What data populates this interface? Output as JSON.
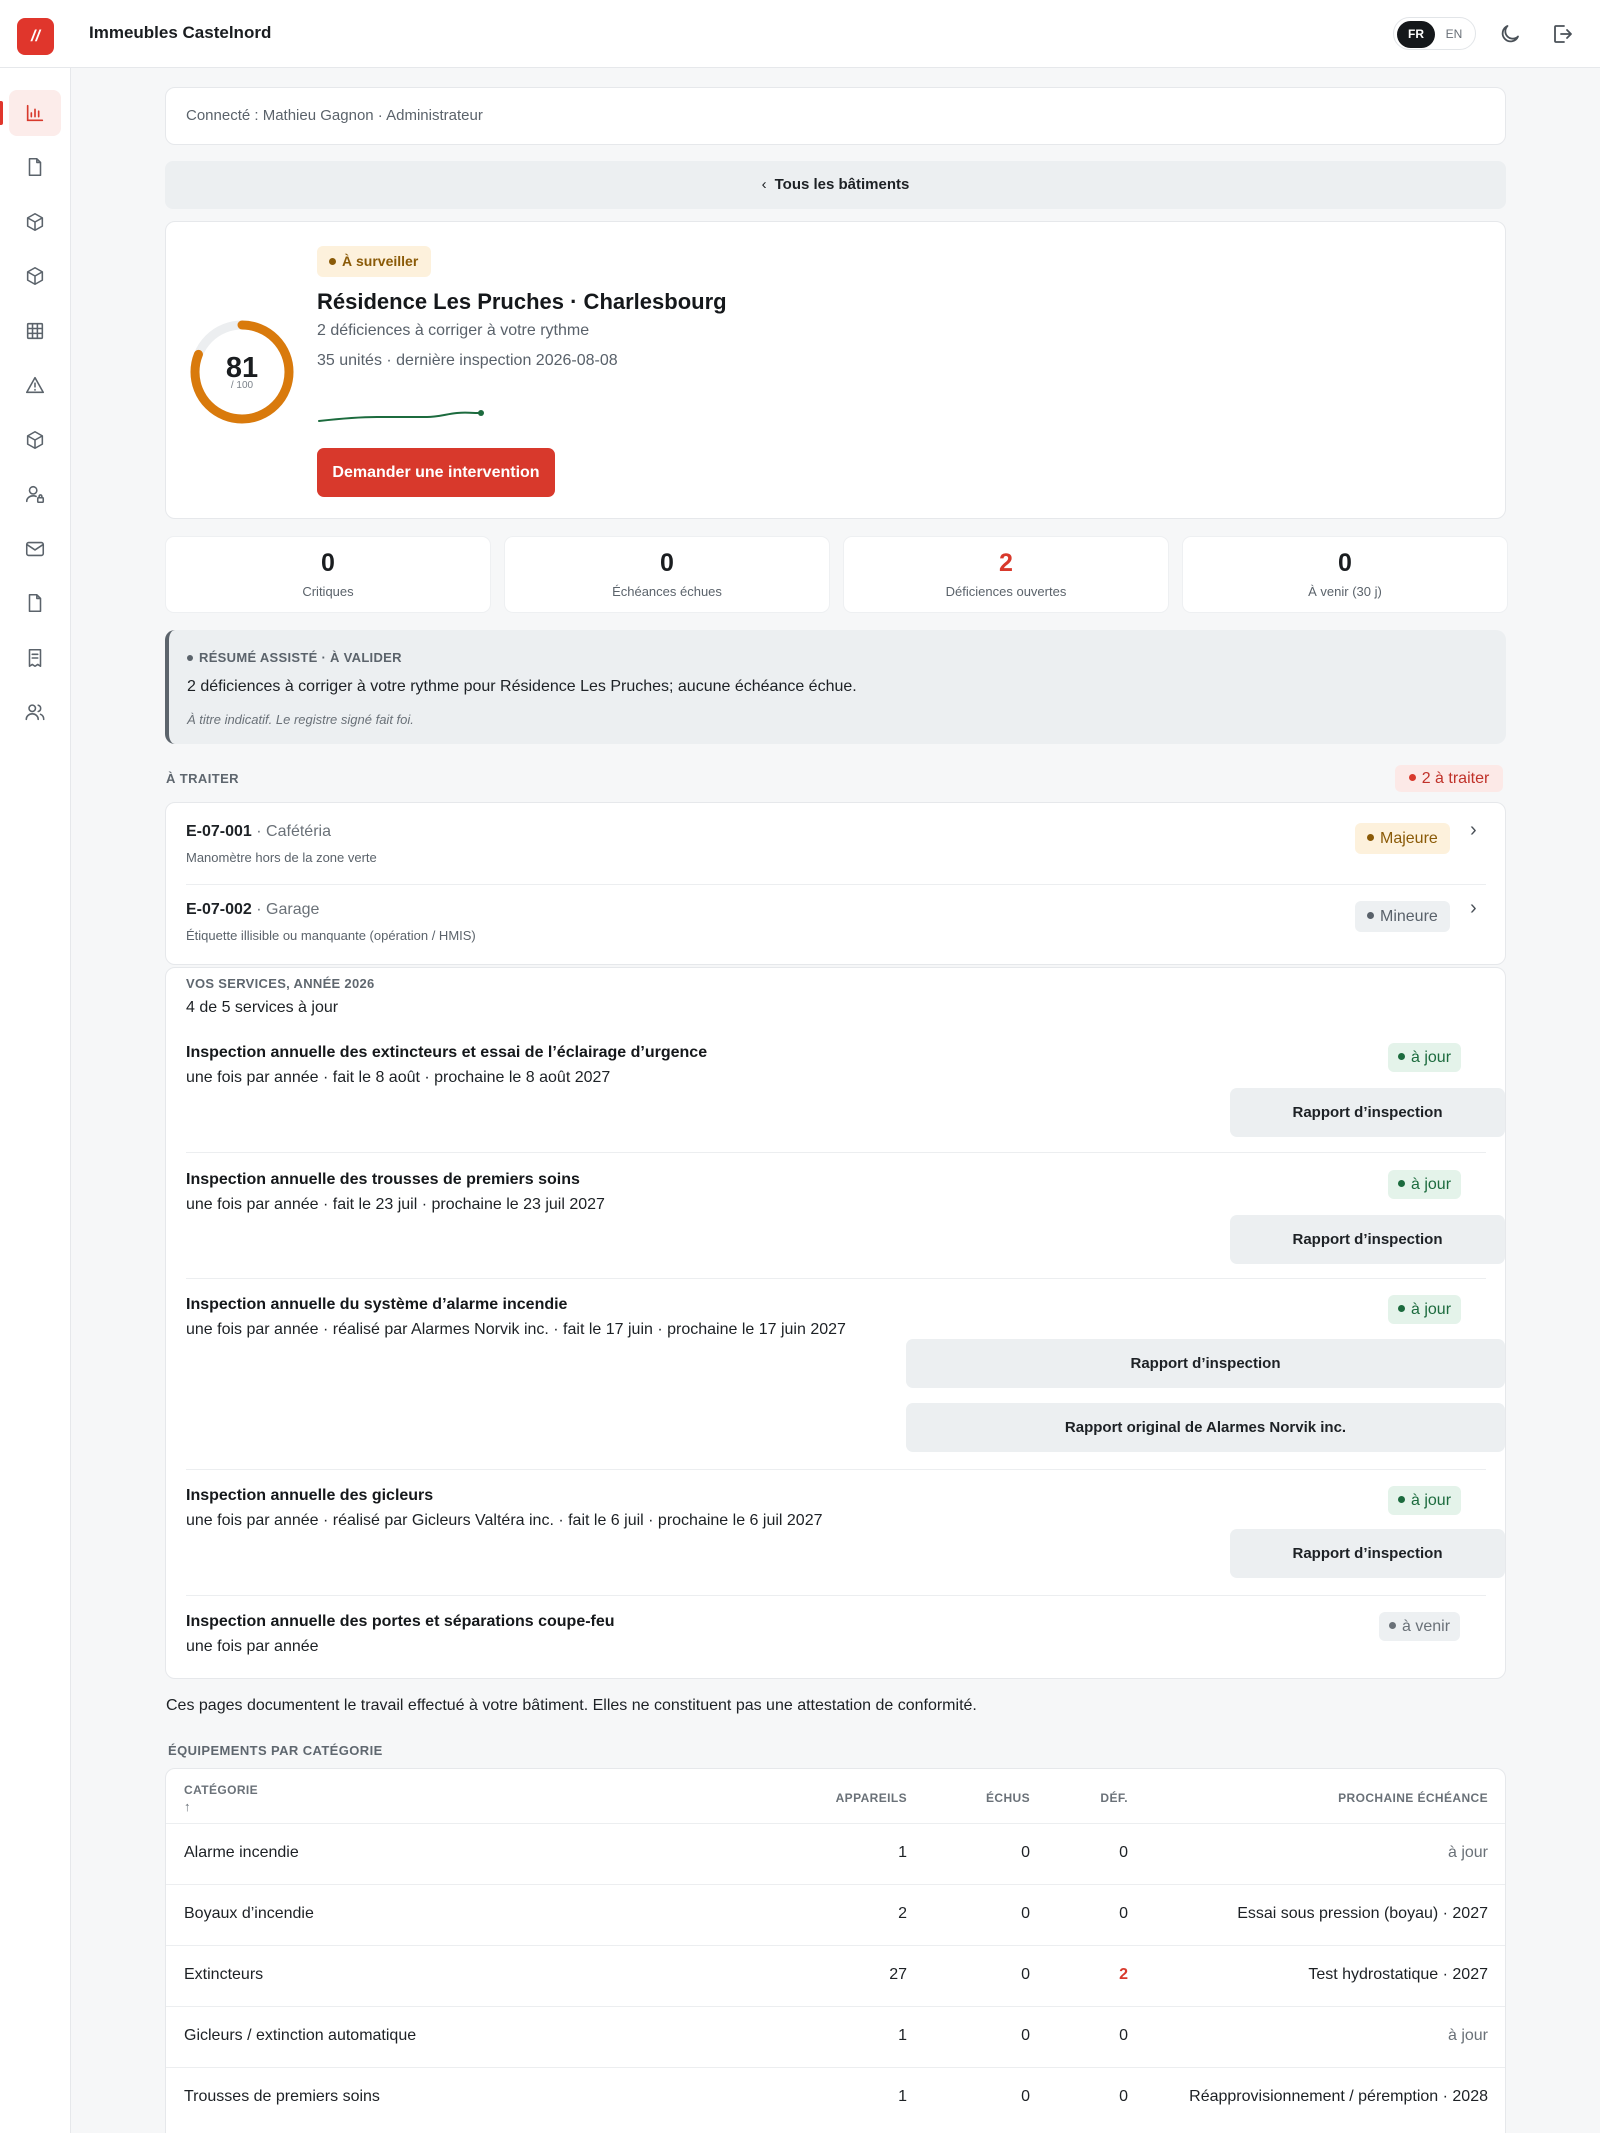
{
  "app": {
    "logo": "//",
    "title": "Immeubles Castelnord"
  },
  "lang": {
    "fr": "FR",
    "en": "EN"
  },
  "session": {
    "connected": "Connecté : Mathieu Gagnon · Administrateur"
  },
  "nav": {
    "back": "Tous les bâtiments"
  },
  "building": {
    "status": "À surveiller",
    "name": "Résidence Les Pruches · Charlesbourg",
    "line1": "2 déficiences à corriger à votre rythme",
    "line2": "35 unités · dernière inspection 2026-08-08",
    "score": "81",
    "score_max": "/ 100",
    "score_value": 81,
    "cta": "Demander une intervention"
  },
  "stats": [
    {
      "value": "0",
      "label": "Critiques"
    },
    {
      "value": "0",
      "label": "Échéances échues"
    },
    {
      "value": "2",
      "label": "Déficiences ouvertes"
    },
    {
      "value": "0",
      "label": "À venir (30 j)"
    }
  ],
  "summary": {
    "heading": "RÉSUMÉ ASSISTÉ · À VALIDER",
    "text": "2 déficiences à corriger à votre rythme pour Résidence Les Pruches; aucune échéance échue.",
    "note": "À titre indicatif. Le registre signé fait foi."
  },
  "todo": {
    "label": "À TRAITER",
    "count": "2 à traiter",
    "items": [
      {
        "code": "E-07-001",
        "location": " · Cafétéria",
        "desc": "Manomètre hors de la zone verte",
        "severity": "Majeure"
      },
      {
        "code": "E-07-002",
        "location": " · Garage",
        "desc": "Étiquette illisible ou manquante (opération / HMIS)",
        "severity": "Mineure"
      }
    ]
  },
  "services": {
    "heading": "VOS SERVICES, ANNÉE 2026",
    "count": "4 de 5 services à jour",
    "items": [
      {
        "title": "Inspection annuelle des extincteurs et essai de l’éclairage d’urgence",
        "detail": "une fois par année · fait le 8 août · prochaine le 8 août 2027",
        "status": "à jour",
        "buttons": [
          "Rapport d’inspection"
        ]
      },
      {
        "title": "Inspection annuelle des trousses de premiers soins",
        "detail": "une fois par année · fait le 23 juil · prochaine le 23 juil 2027",
        "status": "à jour",
        "buttons": [
          "Rapport d’inspection"
        ]
      },
      {
        "title": "Inspection annuelle du système d’alarme incendie",
        "detail": "une fois par année · réalisé par Alarmes Norvik inc. · fait le 17 juin · prochaine le 17 juin 2027",
        "status": "à jour",
        "buttons": [
          "Rapport d’inspection",
          "Rapport original de Alarmes Norvik inc."
        ]
      },
      {
        "title": "Inspection annuelle des gicleurs",
        "detail": "une fois par année · réalisé par Gicleurs Valtéra inc. · fait le 6 juil · prochaine le 6 juil 2027",
        "status": "à jour",
        "buttons": [
          "Rapport d’inspection"
        ]
      },
      {
        "title": "Inspection annuelle des portes et séparations coupe-feu",
        "detail": "une fois par année",
        "status": "à venir",
        "buttons": []
      }
    ]
  },
  "disclaimer": "Ces pages documentent le travail effectué à votre bâtiment. Elles ne constituent pas une attestation de conformité.",
  "equipment": {
    "label": "ÉQUIPEMENTS PAR CATÉGORIE",
    "headers": {
      "category": "CATÉGORIE",
      "sort": "↑",
      "devices": "APPAREILS",
      "overdue": "ÉCHUS",
      "def": "DÉF.",
      "next": "PROCHAINE ÉCHÉANCE"
    },
    "rows": [
      {
        "category": "Alarme incendie",
        "devices": "1",
        "overdue": "0",
        "def": "0",
        "next": "à jour"
      },
      {
        "category": "Boyaux d’incendie",
        "devices": "2",
        "overdue": "0",
        "def": "0",
        "next": "Essai sous pression (boyau) · 2027"
      },
      {
        "category": "Extincteurs",
        "devices": "27",
        "overdue": "0",
        "def": "2",
        "next": "Test hydrostatique · 2027"
      },
      {
        "category": "Gicleurs / extinction automatique",
        "devices": "1",
        "overdue": "0",
        "def": "0",
        "next": "à jour"
      },
      {
        "category": "Trousses de premiers soins",
        "devices": "1",
        "overdue": "0",
        "def": "0",
        "next": "Réapprovisionnement / péremption · 2028"
      }
    ]
  },
  "colors": {
    "accent": "#d8392c",
    "warning": "#d97a0c",
    "ok": "#1c6b3e",
    "spark": "#1c6b3e"
  }
}
